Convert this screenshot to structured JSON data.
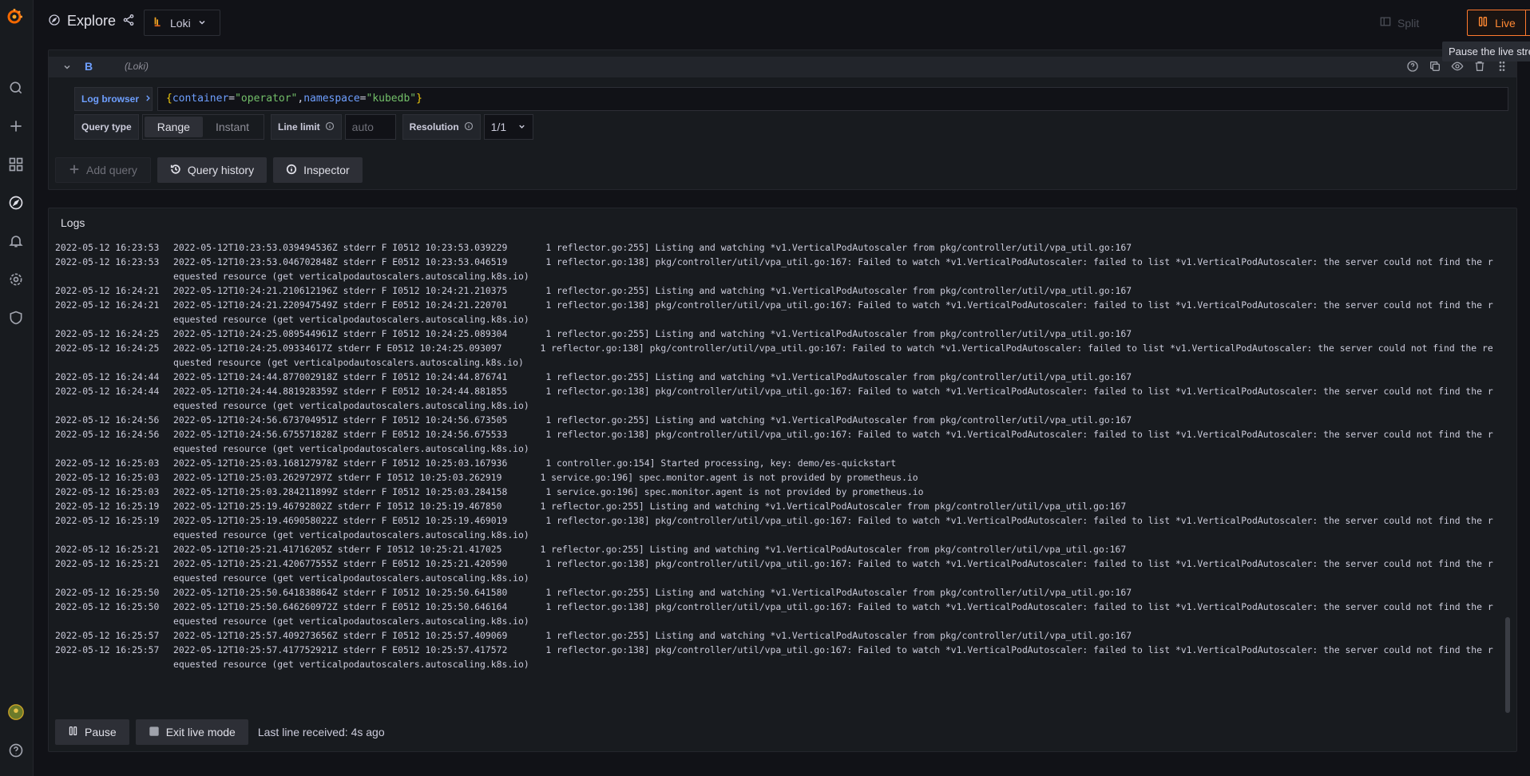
{
  "header": {
    "title": "Explore",
    "datasource": "Loki",
    "split_label": "Split",
    "live_label": "Live",
    "tooltip": "Pause the live stream"
  },
  "query": {
    "ref": "B",
    "datasource_note": "(Loki)",
    "log_browser_label": "Log browser",
    "expr_parts": [
      "{",
      "container",
      "=",
      "\"operator\"",
      ",",
      "namespace",
      "=",
      "\"kubedb\"",
      "}"
    ],
    "query_type_label": "Query type",
    "query_type_options": [
      "Range",
      "Instant"
    ],
    "line_limit_label": "Line limit",
    "line_limit_placeholder": "auto",
    "resolution_label": "Resolution",
    "resolution_value": "1/1"
  },
  "query_buttons": {
    "add_query": "Add query",
    "query_history": "Query history",
    "inspector": "Inspector"
  },
  "logs": {
    "title": "Logs",
    "lines": [
      {
        "ts": "2022-05-12 16:23:53",
        "msg": "2022-05-12T10:23:53.039494536Z stderr F I0512 10:23:53.039229       1 reflector.go:255] Listing and watching *v1.VerticalPodAutoscaler from pkg/controller/util/vpa_util.go:167"
      },
      {
        "ts": "2022-05-12 16:23:53",
        "msg": "2022-05-12T10:23:53.046702848Z stderr F E0512 10:23:53.046519       1 reflector.go:138] pkg/controller/util/vpa_util.go:167: Failed to watch *v1.VerticalPodAutoscaler: failed to list *v1.VerticalPodAutoscaler: the server could not find the requested resource (get verticalpodautoscalers.autoscaling.k8s.io)"
      },
      {
        "ts": "2022-05-12 16:24:21",
        "msg": "2022-05-12T10:24:21.210612196Z stderr F I0512 10:24:21.210375       1 reflector.go:255] Listing and watching *v1.VerticalPodAutoscaler from pkg/controller/util/vpa_util.go:167"
      },
      {
        "ts": "2022-05-12 16:24:21",
        "msg": "2022-05-12T10:24:21.220947549Z stderr F E0512 10:24:21.220701       1 reflector.go:138] pkg/controller/util/vpa_util.go:167: Failed to watch *v1.VerticalPodAutoscaler: failed to list *v1.VerticalPodAutoscaler: the server could not find the requested resource (get verticalpodautoscalers.autoscaling.k8s.io)"
      },
      {
        "ts": "2022-05-12 16:24:25",
        "msg": "2022-05-12T10:24:25.089544961Z stderr F I0512 10:24:25.089304       1 reflector.go:255] Listing and watching *v1.VerticalPodAutoscaler from pkg/controller/util/vpa_util.go:167"
      },
      {
        "ts": "2022-05-12 16:24:25",
        "msg": "2022-05-12T10:24:25.09334617Z stderr F E0512 10:24:25.093097       1 reflector.go:138] pkg/controller/util/vpa_util.go:167: Failed to watch *v1.VerticalPodAutoscaler: failed to list *v1.VerticalPodAutoscaler: the server could not find the requested resource (get verticalpodautoscalers.autoscaling.k8s.io)"
      },
      {
        "ts": "2022-05-12 16:24:44",
        "msg": "2022-05-12T10:24:44.877002918Z stderr F I0512 10:24:44.876741       1 reflector.go:255] Listing and watching *v1.VerticalPodAutoscaler from pkg/controller/util/vpa_util.go:167"
      },
      {
        "ts": "2022-05-12 16:24:44",
        "msg": "2022-05-12T10:24:44.881928359Z stderr F E0512 10:24:44.881855       1 reflector.go:138] pkg/controller/util/vpa_util.go:167: Failed to watch *v1.VerticalPodAutoscaler: failed to list *v1.VerticalPodAutoscaler: the server could not find the requested resource (get verticalpodautoscalers.autoscaling.k8s.io)"
      },
      {
        "ts": "2022-05-12 16:24:56",
        "msg": "2022-05-12T10:24:56.673704951Z stderr F I0512 10:24:56.673505       1 reflector.go:255] Listing and watching *v1.VerticalPodAutoscaler from pkg/controller/util/vpa_util.go:167"
      },
      {
        "ts": "2022-05-12 16:24:56",
        "msg": "2022-05-12T10:24:56.675571828Z stderr F E0512 10:24:56.675533       1 reflector.go:138] pkg/controller/util/vpa_util.go:167: Failed to watch *v1.VerticalPodAutoscaler: failed to list *v1.VerticalPodAutoscaler: the server could not find the requested resource (get verticalpodautoscalers.autoscaling.k8s.io)"
      },
      {
        "ts": "2022-05-12 16:25:03",
        "msg": "2022-05-12T10:25:03.168127978Z stderr F I0512 10:25:03.167936       1 controller.go:154] Started processing, key: demo/es-quickstart"
      },
      {
        "ts": "2022-05-12 16:25:03",
        "msg": "2022-05-12T10:25:03.26297297Z stderr F I0512 10:25:03.262919       1 service.go:196] spec.monitor.agent is not provided by prometheus.io"
      },
      {
        "ts": "2022-05-12 16:25:03",
        "msg": "2022-05-12T10:25:03.284211899Z stderr F I0512 10:25:03.284158       1 service.go:196] spec.monitor.agent is not provided by prometheus.io"
      },
      {
        "ts": "2022-05-12 16:25:19",
        "msg": "2022-05-12T10:25:19.46792802Z stderr F I0512 10:25:19.467850       1 reflector.go:255] Listing and watching *v1.VerticalPodAutoscaler from pkg/controller/util/vpa_util.go:167"
      },
      {
        "ts": "2022-05-12 16:25:19",
        "msg": "2022-05-12T10:25:19.469058022Z stderr F E0512 10:25:19.469019       1 reflector.go:138] pkg/controller/util/vpa_util.go:167: Failed to watch *v1.VerticalPodAutoscaler: failed to list *v1.VerticalPodAutoscaler: the server could not find the requested resource (get verticalpodautoscalers.autoscaling.k8s.io)"
      },
      {
        "ts": "2022-05-12 16:25:21",
        "msg": "2022-05-12T10:25:21.41716205Z stderr F I0512 10:25:21.417025       1 reflector.go:255] Listing and watching *v1.VerticalPodAutoscaler from pkg/controller/util/vpa_util.go:167"
      },
      {
        "ts": "2022-05-12 16:25:21",
        "msg": "2022-05-12T10:25:21.420677555Z stderr F E0512 10:25:21.420590       1 reflector.go:138] pkg/controller/util/vpa_util.go:167: Failed to watch *v1.VerticalPodAutoscaler: failed to list *v1.VerticalPodAutoscaler: the server could not find the requested resource (get verticalpodautoscalers.autoscaling.k8s.io)"
      },
      {
        "ts": "2022-05-12 16:25:50",
        "msg": "2022-05-12T10:25:50.641838864Z stderr F I0512 10:25:50.641580       1 reflector.go:255] Listing and watching *v1.VerticalPodAutoscaler from pkg/controller/util/vpa_util.go:167"
      },
      {
        "ts": "2022-05-12 16:25:50",
        "msg": "2022-05-12T10:25:50.646260972Z stderr F E0512 10:25:50.646164       1 reflector.go:138] pkg/controller/util/vpa_util.go:167: Failed to watch *v1.VerticalPodAutoscaler: failed to list *v1.VerticalPodAutoscaler: the server could not find the requested resource (get verticalpodautoscalers.autoscaling.k8s.io)"
      },
      {
        "ts": "2022-05-12 16:25:57",
        "msg": "2022-05-12T10:25:57.409273656Z stderr F I0512 10:25:57.409069       1 reflector.go:255] Listing and watching *v1.VerticalPodAutoscaler from pkg/controller/util/vpa_util.go:167"
      },
      {
        "ts": "2022-05-12 16:25:57",
        "msg": "2022-05-12T10:25:57.417752921Z stderr F E0512 10:25:57.417572       1 reflector.go:138] pkg/controller/util/vpa_util.go:167: Failed to watch *v1.VerticalPodAutoscaler: failed to list *v1.VerticalPodAutoscaler: the server could not find the requested resource (get verticalpodautoscalers.autoscaling.k8s.io)"
      }
    ],
    "pause_label": "Pause",
    "exit_live_label": "Exit live mode",
    "last_line": "Last line received: 4s ago"
  },
  "colors": {
    "accent": "#ff7a2e",
    "link": "#6e9fff",
    "string": "#73bf69",
    "background": "#111217"
  }
}
